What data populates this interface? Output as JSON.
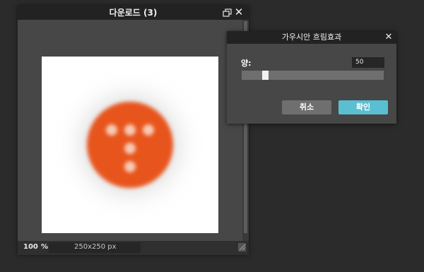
{
  "document_window": {
    "title": "다운로드 (3)",
    "zoom": "100",
    "zoom_unit": "%",
    "image_size": "250x250 px",
    "colors": {
      "titlebar": "#222222",
      "panel": "#474747"
    }
  },
  "image": {
    "description_icon": "t-logo-dots",
    "circle_color": "#e8541e",
    "dot_color": "#f7c9b4",
    "blur_amount": 50
  },
  "blur_dialog": {
    "title": "가우시안 흐림효과",
    "close_icon": "close-icon",
    "amount_label": "양:",
    "amount_value": "50",
    "slider_fraction": 0.15,
    "cancel_label": "취소",
    "ok_label": "확인",
    "colors": {
      "ok_button": "#5bbfd2",
      "cancel_button": "#6f6f6f"
    }
  }
}
